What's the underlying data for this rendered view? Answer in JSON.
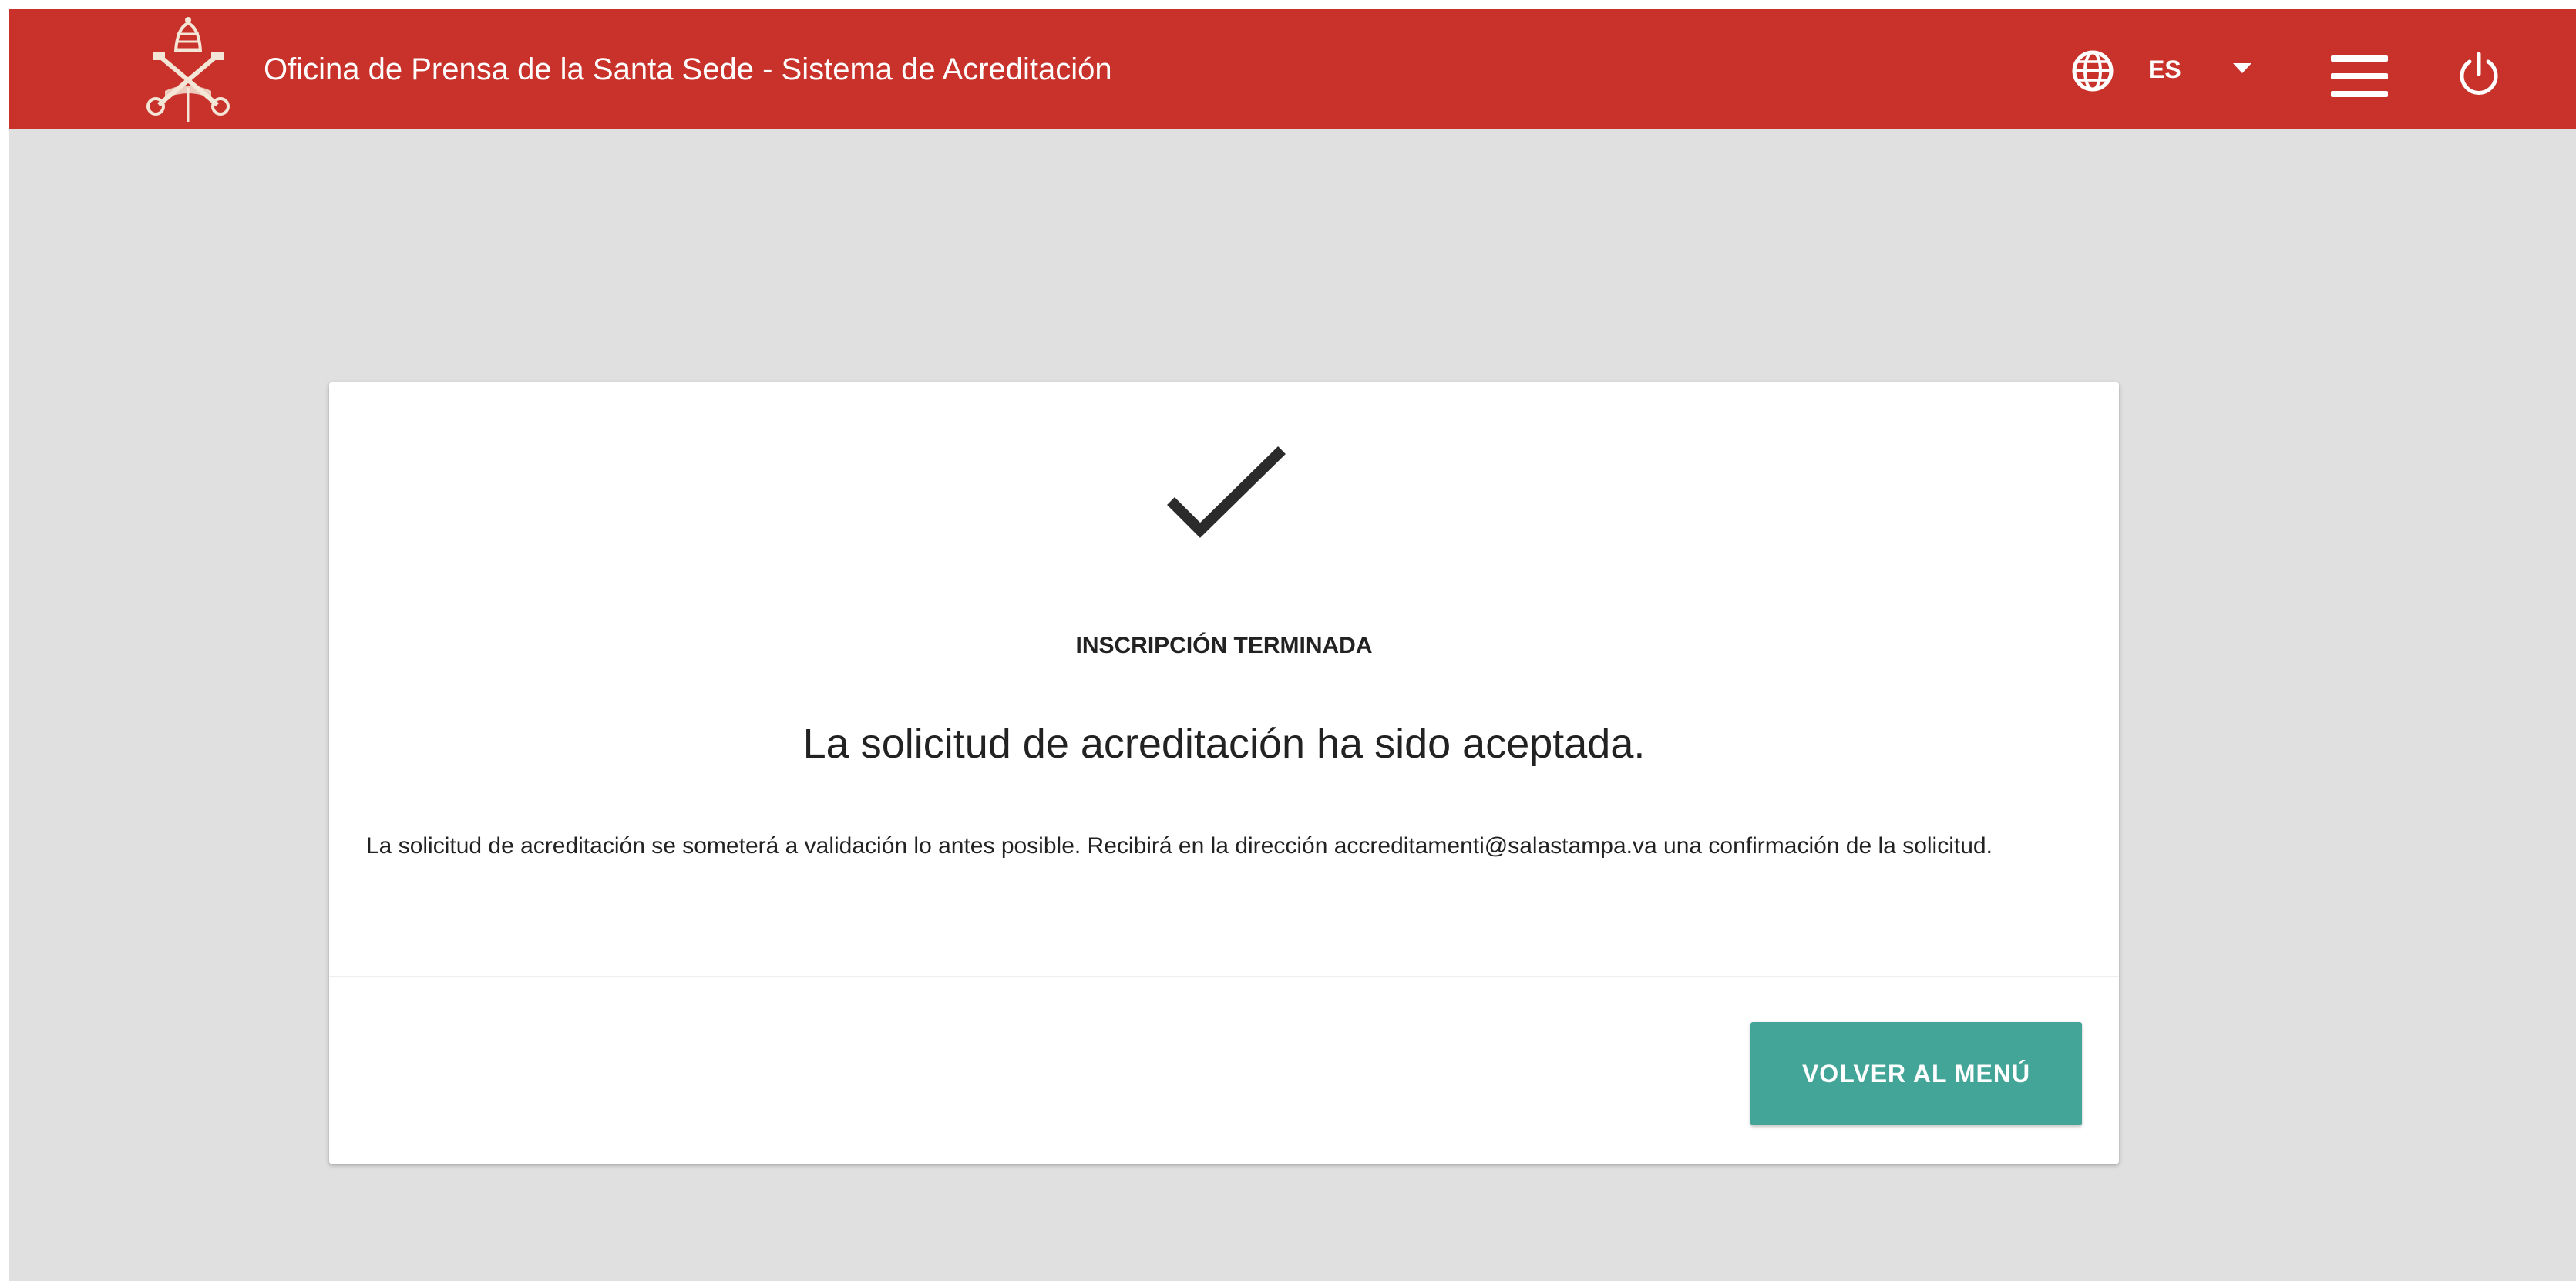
{
  "header": {
    "title": "Oficina de Prensa de la Santa Sede - Sistema de Acreditación",
    "logo_icon": "papal-coat-of-arms-icon",
    "background_color": "#c8322a",
    "language": {
      "icon": "globe-icon",
      "selected": "ES",
      "dropdown_icon": "caret-down-icon"
    },
    "menu_icon": "hamburger-menu-icon",
    "logout_icon": "power-icon"
  },
  "confirmation": {
    "icon": "checkmark-icon",
    "status_label": "INSCRIPCIÓN TERMINADA",
    "headline": "La solicitud de acreditación ha sido aceptada.",
    "message": "La solicitud de acreditación se someterá a validación lo antes posible. Recibirá en la dirección accreditamenti@salastampa.va una confirmación de la solicitud.",
    "back_button_label": "VOLVER AL MENÚ",
    "button_color": "#42a597"
  }
}
